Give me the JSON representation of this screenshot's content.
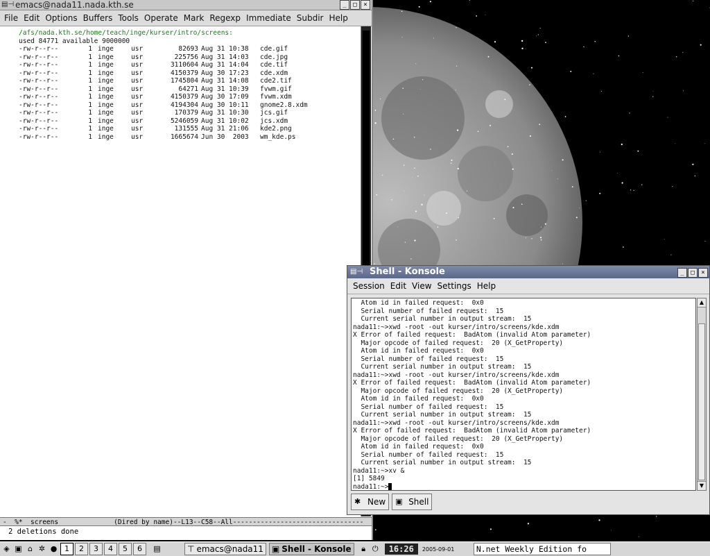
{
  "emacs": {
    "title": "emacs@nada11.nada.kth.se",
    "menu": [
      "File",
      "Edit",
      "Options",
      "Buffers",
      "Tools",
      "Operate",
      "Mark",
      "Regexp",
      "Immediate",
      "Subdir",
      "Help"
    ],
    "path_line": "/afs/nada.kth.se/home/teach/inge/kurser/intro/screens:",
    "used_line": "used 84771 available 9000000",
    "files": [
      {
        "perm": "-rw-r--r--",
        "links": "1",
        "owner": "inge",
        "group": "usr",
        "size": "82693",
        "date": "Aug 31 10:38",
        "name": "cde.gif"
      },
      {
        "perm": "-rw-r--r--",
        "links": "1",
        "owner": "inge",
        "group": "usr",
        "size": "225756",
        "date": "Aug 31 14:03",
        "name": "cde.jpg"
      },
      {
        "perm": "-rw-r--r--",
        "links": "1",
        "owner": "inge",
        "group": "usr",
        "size": "3110604",
        "date": "Aug 31 14:04",
        "name": "cde.tif"
      },
      {
        "perm": "-rw-r--r--",
        "links": "1",
        "owner": "inge",
        "group": "usr",
        "size": "4150379",
        "date": "Aug 30 17:23",
        "name": "cde.xdm"
      },
      {
        "perm": "-rw-r--r--",
        "links": "1",
        "owner": "inge",
        "group": "usr",
        "size": "1745804",
        "date": "Aug 31 14:08",
        "name": "cde2.tif"
      },
      {
        "perm": "-rw-r--r--",
        "links": "1",
        "owner": "inge",
        "group": "usr",
        "size": "64271",
        "date": "Aug 31 10:39",
        "name": "fvwm.gif"
      },
      {
        "perm": "-rw-r--r--",
        "links": "1",
        "owner": "inge",
        "group": "usr",
        "size": "4150379",
        "date": "Aug 30 17:09",
        "name": "fvwm.xdm"
      },
      {
        "perm": "-rw-r--r--",
        "links": "1",
        "owner": "inge",
        "group": "usr",
        "size": "4194304",
        "date": "Aug 30 10:11",
        "name": "gnome2.8.xdm"
      },
      {
        "perm": "-rw-r--r--",
        "links": "1",
        "owner": "inge",
        "group": "usr",
        "size": "170379",
        "date": "Aug 31 10:30",
        "name": "jcs.gif"
      },
      {
        "perm": "-rw-r--r--",
        "links": "1",
        "owner": "inge",
        "group": "usr",
        "size": "5246059",
        "date": "Aug 31 10:02",
        "name": "jcs.xdm"
      },
      {
        "perm": "-rw-r--r--",
        "links": "1",
        "owner": "inge",
        "group": "usr",
        "size": "131555",
        "date": "Aug 31 21:06",
        "name": "kde2.png"
      },
      {
        "perm": "-rw-r--r--",
        "links": "1",
        "owner": "inge",
        "group": "usr",
        "size": "1665674",
        "date": "Jun 30  2003",
        "name": "wm_kde.ps"
      }
    ],
    "modeline": "-  %*  screens              (Dired by name)--L13--C58--All---------------------------------",
    "minibuffer": "2 deletions done"
  },
  "konsole": {
    "title": "Shell - Konsole",
    "menu": [
      "Session",
      "Edit",
      "View",
      "Settings",
      "Help"
    ],
    "lines": [
      "  Atom id in failed request:  0x0",
      "  Serial number of failed request:  15",
      "  Current serial number in output stream:  15",
      "nada11:~>xwd -root -out kurser/intro/screens/kde.xdm",
      "X Error of failed request:  BadAtom (invalid Atom parameter)",
      "  Major opcode of failed request:  20 (X_GetProperty)",
      "  Atom id in failed request:  0x0",
      "  Serial number of failed request:  15",
      "  Current serial number in output stream:  15",
      "nada11:~>xwd -root -out kurser/intro/screens/kde.xdm",
      "X Error of failed request:  BadAtom (invalid Atom parameter)",
      "  Major opcode of failed request:  20 (X_GetProperty)",
      "  Atom id in failed request:  0x0",
      "  Serial number of failed request:  15",
      "  Current serial number in output stream:  15",
      "nada11:~>xwd -root -out kurser/intro/screens/kde.xdm",
      "X Error of failed request:  BadAtom (invalid Atom parameter)",
      "  Major opcode of failed request:  20 (X_GetProperty)",
      "  Atom id in failed request:  0x0",
      "  Serial number of failed request:  15",
      "  Current serial number in output stream:  15",
      "nada11:~>xv &",
      "[1] 5849",
      "nada11:~>"
    ],
    "tabs": {
      "new": "New",
      "shell": "Shell"
    }
  },
  "taskbar": {
    "desktops": [
      "1",
      "2",
      "3",
      "4",
      "5",
      "6"
    ],
    "tasks": [
      "emacs@nada11",
      "Shell - Konsole"
    ],
    "clock": "16:26",
    "date": "2005-09-01",
    "ticker": "N.net Weekly Edition fo"
  },
  "colors": {
    "path_green": "#1a7a1a",
    "konsole_titlebar": "#5b6889",
    "desktop_bg": "#000000"
  },
  "icons": [
    "window-menu-icon",
    "minimize-icon",
    "maximize-icon",
    "close-icon",
    "new-session-icon",
    "shell-icon",
    "kde-menu-icon",
    "lock-icon",
    "logout-icon"
  ]
}
